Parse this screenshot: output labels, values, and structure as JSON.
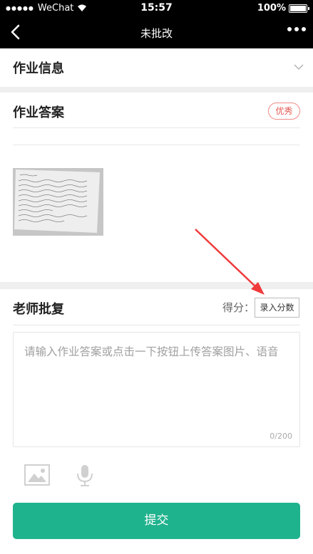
{
  "status_bar": {
    "carrier": "WeChat",
    "time": "15:57",
    "battery": "100%"
  },
  "nav": {
    "title": "未批改"
  },
  "info_section": {
    "title": "作业信息"
  },
  "answer_section": {
    "title": "作业答案",
    "badge": "优秀"
  },
  "teacher_section": {
    "title": "老师批复",
    "score_label": "得分：",
    "score_button": "录入分数",
    "reply_placeholder": "请输入作业答案或点击一下按钮上传答案图片、语音",
    "counter": "0/200"
  },
  "submit_label": "提交",
  "colors": {
    "accent": "#1fb38d",
    "badge": "#e5554f",
    "annotation_arrow": "#f03a3a"
  },
  "icons": [
    "back-icon",
    "more-icon",
    "chevron-down-icon",
    "image-icon",
    "microphone-icon"
  ]
}
